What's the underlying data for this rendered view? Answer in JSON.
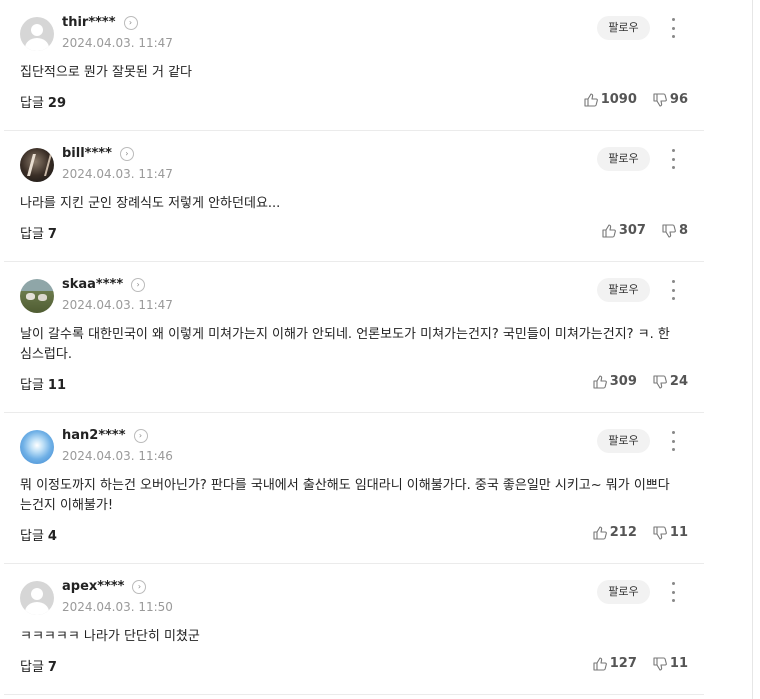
{
  "follow_label": "팔로우",
  "reply_label": "답글",
  "comments": [
    {
      "username": "thir****",
      "timestamp": "2024.04.03. 11:47",
      "avatar": "default-avatar",
      "text": "집단적으로 뭔가 잘못된 거 같다",
      "reply_count": "29",
      "likes": "1090",
      "dislikes": "96"
    },
    {
      "username": "bill****",
      "timestamp": "2024.04.03. 11:47",
      "avatar": "dark-figure-avatar",
      "text": "나라를 지킨 군인 장례식도 저렇게 안하던데요...",
      "reply_count": "7",
      "likes": "307",
      "dislikes": "8"
    },
    {
      "username": "skaa****",
      "timestamp": "2024.04.03. 11:47",
      "avatar": "sheep-field-avatar",
      "text": "날이 갈수록 대한민국이 왜 이렇게 미쳐가는지 이해가 안되네. 언론보도가 미쳐가는건지? 국민들이 미쳐가는건지? ㅋ. 한심스럽다.",
      "reply_count": "11",
      "likes": "309",
      "dislikes": "24"
    },
    {
      "username": "han2****",
      "timestamp": "2024.04.03. 11:46",
      "avatar": "blue-sky-avatar",
      "text": "뭐 이정도까지 하는건 오버아닌가? 판다를 국내에서 출산해도 임대라니 이해불가다. 중국 좋은일만 시키고~ 뭐가 이쁘다는건지 이해불가!",
      "reply_count": "4",
      "likes": "212",
      "dislikes": "11"
    },
    {
      "username": "apex****",
      "timestamp": "2024.04.03. 11:50",
      "avatar": "default-avatar",
      "text": "ㅋㅋㅋㅋㅋ 나라가 단단히 미쳤군",
      "reply_count": "7",
      "likes": "127",
      "dislikes": "11"
    }
  ]
}
